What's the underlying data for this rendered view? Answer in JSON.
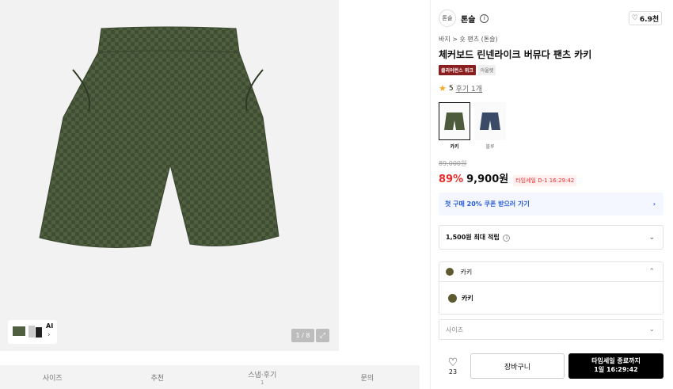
{
  "gallery": {
    "counter": "1 / 8",
    "thumb_label": "AI",
    "thumb_chevron": "›"
  },
  "tabs": [
    {
      "label": "사이즈"
    },
    {
      "label": "추천"
    },
    {
      "label": "스냅·후기",
      "count": "1"
    },
    {
      "label": "문의"
    }
  ],
  "brand": {
    "logo_text": "톤슬",
    "name": "톤슬",
    "likes": "6.9천"
  },
  "breadcrumb": "바지 > 숏 팬츠 (톤슬)",
  "product": {
    "title": "체커보드 린넨라이크 버뮤다 팬츠 카키",
    "badge_primary": "클리어런스 위크",
    "badge_secondary": "아울렛",
    "rating": "5",
    "review_link": "후기 1개"
  },
  "colors": [
    {
      "label": "카키",
      "swatch": "#4d5a3c",
      "selected": true
    },
    {
      "label": "블루",
      "swatch": "#3b4a66",
      "selected": false
    }
  ],
  "pricing": {
    "original": "89,000원",
    "discount": "89%",
    "price": "9,900원",
    "timesale": "타임세일 D-1 16:29:42"
  },
  "coupon": "첫 구매 20% 쿠폰 받으러 가기",
  "points": "1,500원 최대 적립",
  "color_select": {
    "value": "카키",
    "option": "카키"
  },
  "size_select": {
    "placeholder": "사이즈"
  },
  "actions": {
    "wish_count": "23",
    "cart": "장바구니",
    "buy_line1": "타임세일 종료까지",
    "buy_line2": "1일 16:29:42"
  },
  "theme": {
    "accent_red": "#e62e2e",
    "coupon_blue": "#2a5bd7",
    "badge_red": "#8b1e1e"
  }
}
